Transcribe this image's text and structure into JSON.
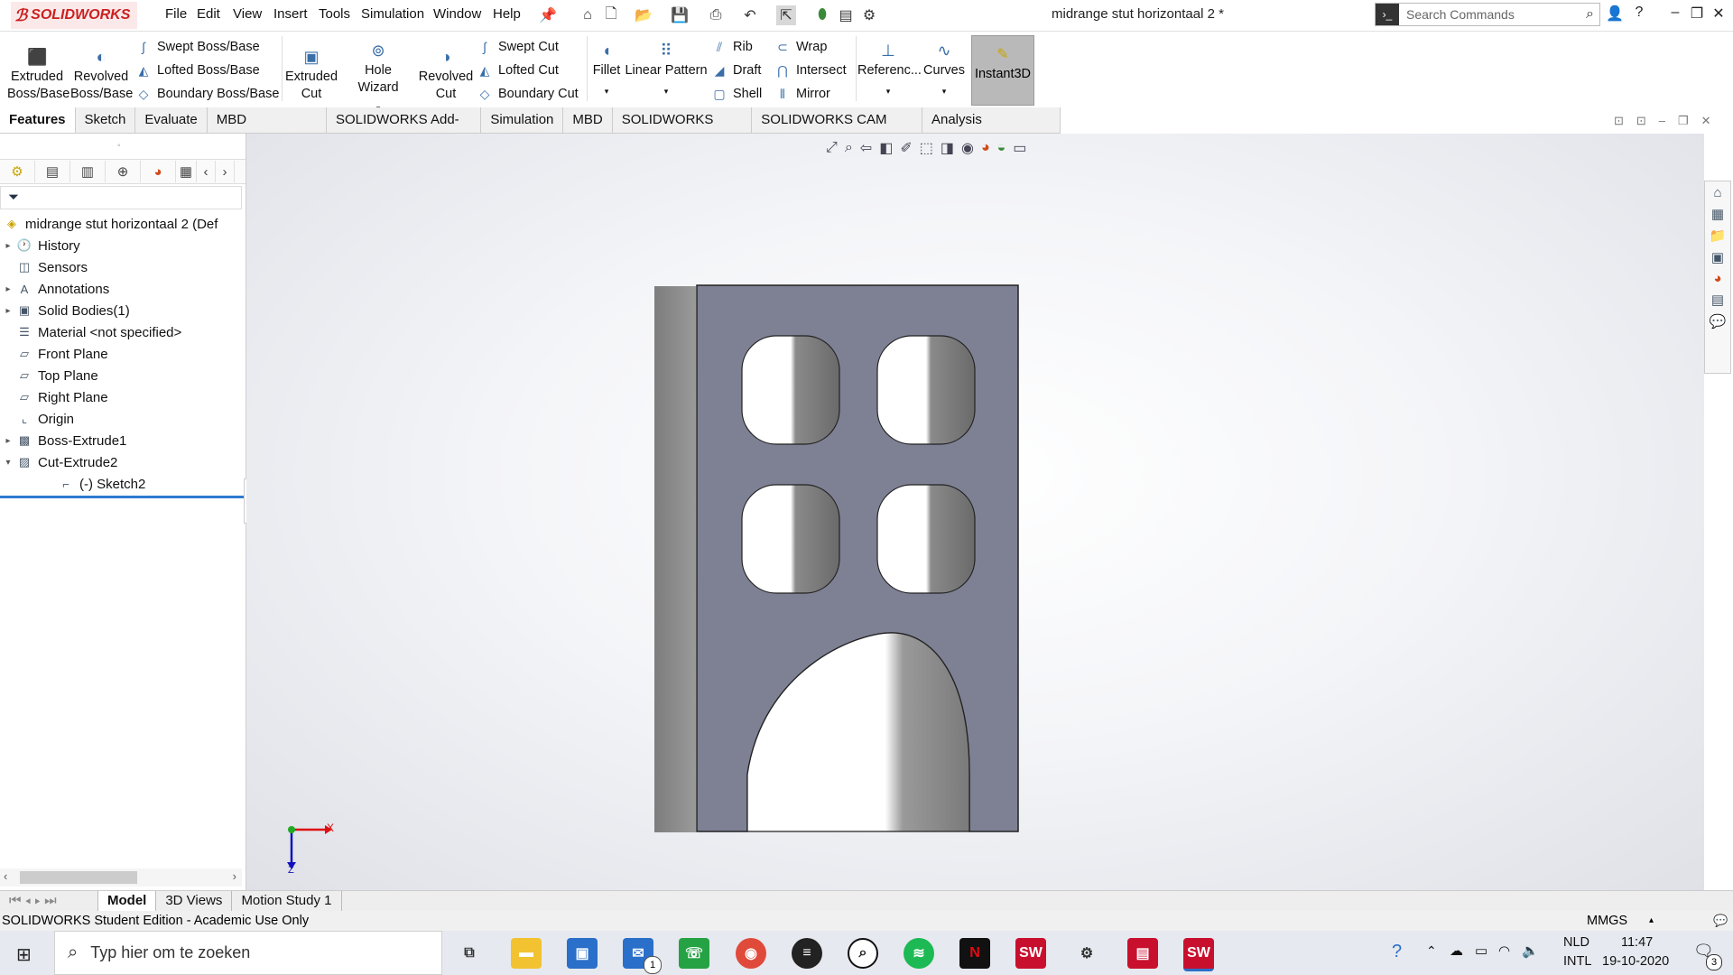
{
  "app": {
    "brand": "SOLIDWORKS",
    "doc_title": "midrange stut horizontaal 2 *"
  },
  "menu": [
    "File",
    "Edit",
    "View",
    "Insert",
    "Tools",
    "Simulation",
    "Window",
    "Help"
  ],
  "search": {
    "placeholder": "Search Commands"
  },
  "commands": {
    "extruded_boss": "Extruded\nBoss/Base",
    "revolved_boss": "Revolved\nBoss/Base",
    "swept_boss": "Swept Boss/Base",
    "lofted_boss": "Lofted Boss/Base",
    "boundary_boss": "Boundary Boss/Base",
    "extruded_cut": "Extruded\nCut",
    "hole_wizard": "Hole Wizard",
    "revolved_cut": "Revolved\nCut",
    "swept_cut": "Swept Cut",
    "lofted_cut": "Lofted Cut",
    "boundary_cut": "Boundary Cut",
    "fillet": "Fillet",
    "linear_pattern": "Linear Pattern",
    "rib": "Rib",
    "draft": "Draft",
    "shell": "Shell",
    "wrap": "Wrap",
    "intersect": "Intersect",
    "mirror": "Mirror",
    "reference": "Referenc...",
    "curves": "Curves",
    "instant3d": "Instant3D"
  },
  "tabs": [
    "Features",
    "Sketch",
    "Evaluate",
    "MBD Dimensions",
    "SOLIDWORKS Add-Ins",
    "Simulation",
    "MBD",
    "SOLIDWORKS CAM",
    "SOLIDWORKS CAM TBM",
    "Analysis Preparation"
  ],
  "tree": {
    "root": "midrange stut horizontaal 2  (Def",
    "items": [
      {
        "label": "History",
        "icon": "history-folder-icon",
        "expand": "▸"
      },
      {
        "label": "Sensors",
        "icon": "sensors-icon",
        "expand": ""
      },
      {
        "label": "Annotations",
        "icon": "annotations-icon",
        "expand": "▸"
      },
      {
        "label": "Solid Bodies(1)",
        "icon": "solid-bodies-icon",
        "expand": "▸"
      },
      {
        "label": "Material <not specified>",
        "icon": "material-icon",
        "expand": ""
      },
      {
        "label": "Front Plane",
        "icon": "plane-icon",
        "expand": ""
      },
      {
        "label": "Top Plane",
        "icon": "plane-icon",
        "expand": ""
      },
      {
        "label": "Right Plane",
        "icon": "plane-icon",
        "expand": ""
      },
      {
        "label": "Origin",
        "icon": "origin-icon",
        "expand": ""
      },
      {
        "label": "Boss-Extrude1",
        "icon": "boss-extrude-icon",
        "expand": "▸"
      },
      {
        "label": "Cut-Extrude2",
        "icon": "cut-extrude-icon",
        "expand": "▾"
      },
      {
        "label": "(-) Sketch2",
        "icon": "sketch-icon",
        "expand": ""
      }
    ]
  },
  "bottom_tabs": [
    "Model",
    "3D Views",
    "Motion Study 1"
  ],
  "status": {
    "left": "SOLIDWORKS Student Edition - Academic Use Only",
    "units": "MMGS"
  },
  "taskbar": {
    "search_placeholder": "Typ hier om te zoeken",
    "lang1": "NLD",
    "lang2": "INTL",
    "time": "11:47",
    "date": "19-10-2020",
    "notif_count": "3",
    "mail_count": "1"
  },
  "triad": {
    "x": "X",
    "z": "Z"
  }
}
